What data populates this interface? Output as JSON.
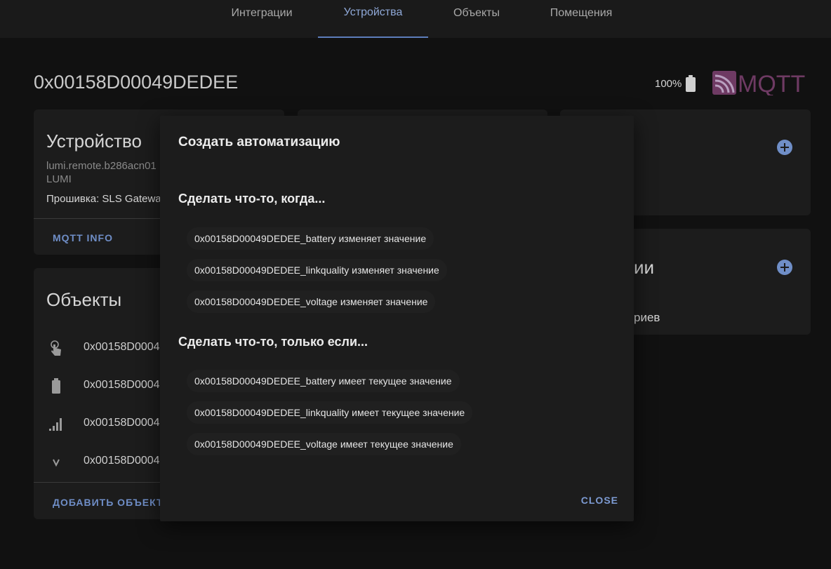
{
  "tabs": [
    {
      "label": "Интеграции",
      "active": false
    },
    {
      "label": "Устройства",
      "active": true
    },
    {
      "label": "Объекты",
      "active": false
    },
    {
      "label": "Помещения",
      "active": false
    }
  ],
  "header": {
    "device_id": "0x00158D00049DEDEE",
    "battery": "100%",
    "battery_icon": "battery-full-icon",
    "logo": "MQTT"
  },
  "device_card": {
    "title": "Устройство",
    "model": "lumi.remote.b286acn01",
    "manufacturer": "LUMI",
    "firmware": "Прошивка: SLS Gatewa",
    "action": "MQTT INFO"
  },
  "entities_card": {
    "title": "Объекты",
    "rows": [
      {
        "icon": "gesture-tap-icon",
        "text": "0x00158D0004"
      },
      {
        "icon": "battery-icon",
        "text": "0x00158D0004"
      },
      {
        "icon": "signal-icon",
        "text": "0x00158D0004"
      },
      {
        "icon": "chevron-down-icon",
        "text": "0x00158D0004"
      }
    ],
    "action": "ДОБАВИТЬ ОБЪЕКТЫ"
  },
  "right_card_2": {
    "title_fragment": "ии",
    "text_fragment": "риев"
  },
  "dialog": {
    "title": "Создать автоматизацию",
    "trigger_title": "Сделать что-то, когда...",
    "triggers": [
      "0x00158D00049DEDEE_battery изменяет значение",
      "0x00158D00049DEDEE_linkquality изменяет значение",
      "0x00158D00049DEDEE_voltage изменяет значение"
    ],
    "condition_title": "Сделать что-то, только если...",
    "conditions": [
      "0x00158D00049DEDEE_battery имеет текущее значение",
      "0x00158D00049DEDEE_linkquality имеет текущее значение",
      "0x00158D00049DEDEE_voltage имеет текущее значение"
    ],
    "close": "CLOSE"
  },
  "colors": {
    "accent": "#6f8ec7",
    "background": "#111111",
    "card": "#1c1c1c"
  }
}
